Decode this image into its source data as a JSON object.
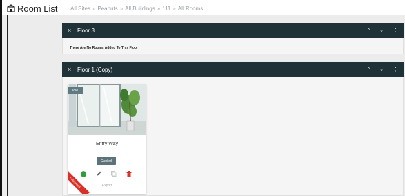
{
  "page": {
    "title": "Room List",
    "title_icon": "building-icon"
  },
  "breadcrumb": [
    {
      "label": "All Sites"
    },
    {
      "label": "Peanuts"
    },
    {
      "label": "All Buildings"
    },
    {
      "label": "111"
    },
    {
      "label": "All Rooms"
    }
  ],
  "breadcrumb_separator": "»",
  "floors": [
    {
      "close_glyph": "×",
      "name": "Floor 3",
      "controls": [
        "^",
        "⌄",
        "⋮"
      ],
      "empty_message": "There Are No Rooms Added To This Floor"
    },
    {
      "close_glyph": "×",
      "name": "Floor 1 (Copy)",
      "controls": [
        "^",
        "⌄",
        "⋮"
      ]
    }
  ],
  "room_card": {
    "status": "Idle",
    "name": "Entry Way",
    "control_label": "Control",
    "export_label": "Export",
    "ribbon_text": "Unlicensed",
    "actions": [
      "shield-icon",
      "pencil-icon",
      "copy-icon",
      "trash-icon"
    ]
  },
  "colors": {
    "header_bg": "#1f3238",
    "control_bg": "#5b7379",
    "ribbon": "#d7322a",
    "shield": "#2e9d3a",
    "trash": "#d7322a"
  }
}
